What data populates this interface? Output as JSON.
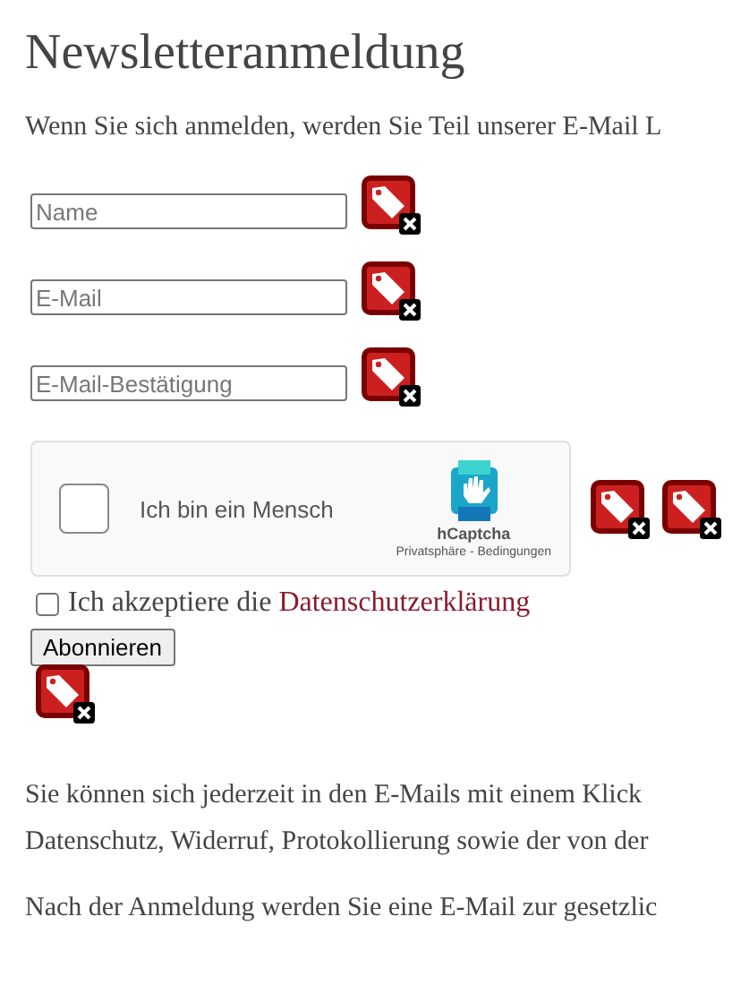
{
  "heading": "Newsletteranmeldung",
  "intro": "Wenn Sie sich anmelden, werden Sie Teil unserer E-Mail L",
  "fields": [
    {
      "placeholder": "Name"
    },
    {
      "placeholder": "E-Mail"
    },
    {
      "placeholder": "E-Mail-Bestätigung"
    }
  ],
  "captcha": {
    "label": "Ich bin ein Mensch",
    "checked": false,
    "brand": "hCaptcha",
    "links": "Privatsphäre - Bedingungen"
  },
  "consent": {
    "label": "Ich akzeptiere die",
    "link": "Datenschutzerklärung",
    "checked": false
  },
  "button": "Abonnieren",
  "info_lines": [
    "Sie können sich jederzeit in den E-Mails mit einem Klick",
    "Datenschutz, Widerruf, Protokollierung sowie der von der"
  ],
  "after_text": "Nach der Anmeldung werden Sie eine E-Mail zur gesetzlic"
}
